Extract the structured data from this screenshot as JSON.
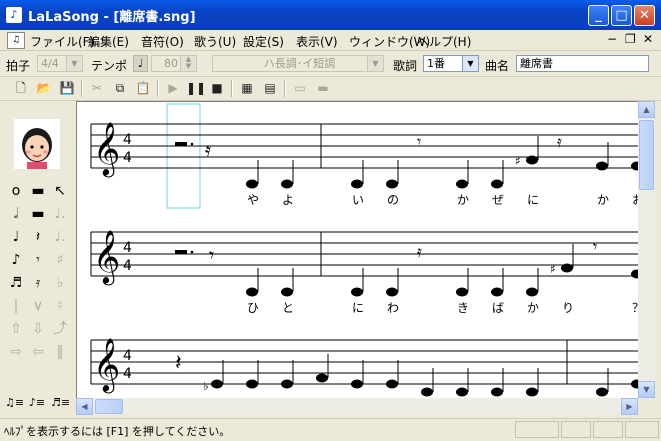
{
  "window": {
    "title": "LaLaSong - [離席書.sng]",
    "icon": "app-icon"
  },
  "menu": [
    "ファイル(F)",
    "編集(E)",
    "音符(O)",
    "歌う(U)",
    "設定(S)",
    "表示(V)",
    "ウィンドウ(W)",
    "ヘルプ(H)"
  ],
  "toolbar1": {
    "beat_label": "拍子",
    "beat_value": "4/4",
    "tempo_label": "テンポ",
    "tempo_value": "80",
    "key_value": "ハ長調･イ短調",
    "verse_label": "歌詞",
    "verse_value": "1番",
    "song_label": "曲名",
    "song_value": "離席書"
  },
  "toolbar2_icons": [
    "new-icon",
    "open-icon",
    "save-icon",
    "cut-icon",
    "copy-icon",
    "paste-icon",
    "play-icon",
    "pause-icon",
    "stop-icon",
    "score-icon",
    "window-icon",
    "small-button-icon",
    "wide-button-icon"
  ],
  "lyrics": {
    "row1": [
      "や",
      "よ",
      "い",
      "の",
      "か",
      "ぜ",
      "に",
      "か",
      "お"
    ],
    "row2": [
      "ひ",
      "と",
      "に",
      "わ",
      "き",
      "ば",
      "か",
      "り",
      "？"
    ]
  },
  "time_signature": {
    "top": "4",
    "bottom": "4"
  },
  "status": {
    "text": "ﾍﾙﾌﾟを表示するには [F1] を押してください。"
  },
  "colors": {
    "titlebar": "#0a3fb8",
    "selection": "#66d9e0",
    "face": "#ece9d8"
  }
}
